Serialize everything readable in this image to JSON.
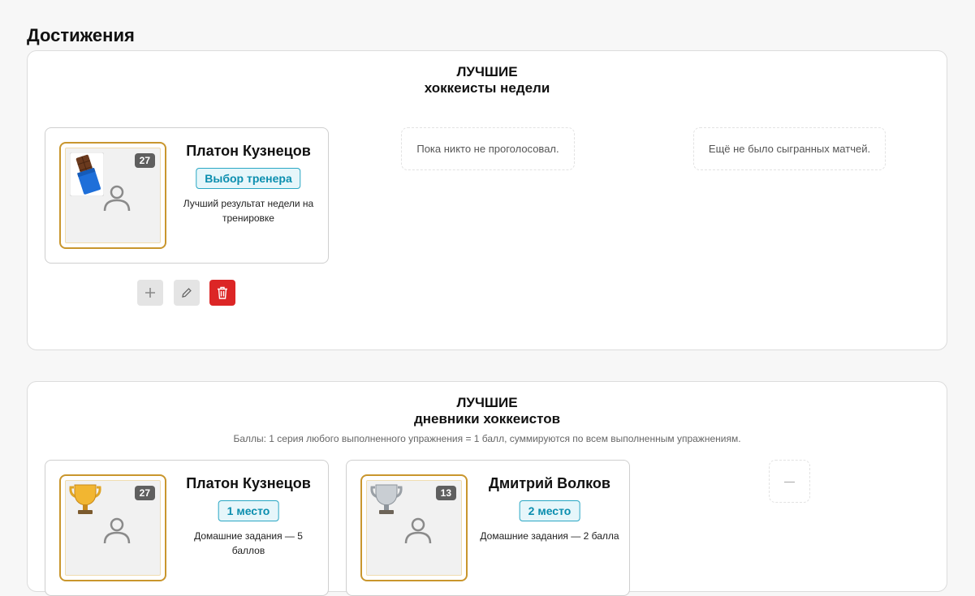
{
  "page": {
    "title": "Достижения"
  },
  "weekly": {
    "heading_line1": "ЛУЧШИЕ",
    "heading_line2": "хоккеисты недели",
    "card": {
      "name": "Платон Кузнецов",
      "count": "27",
      "award": "Выбор тренера",
      "description": "Лучший результат недели на тренировке",
      "badge_icon": "chocolate-bar-icon"
    },
    "empty_votes": "Пока никто не проголосовал.",
    "empty_matches": "Ещё не было сыгранных матчей.",
    "actions": [
      "plus-icon",
      "pencil-icon",
      "trash-icon"
    ]
  },
  "diaries": {
    "heading_line1": "ЛУЧШИЕ",
    "heading_line2": "дневники хоккеистов",
    "note": "Баллы: 1 серия любого выполненного упражнения = 1 балл, суммируются по всем выполненным упражнениям.",
    "cards": [
      {
        "name": "Платон Кузнецов",
        "count": "27",
        "place": "1 место",
        "description": "Домашние задания — 5 баллов",
        "badge_icon": "gold-trophy-icon"
      },
      {
        "name": "Дмитрий Волков",
        "count": "13",
        "place": "2 место",
        "description": "Домашние задания — 2 балла",
        "badge_icon": "silver-trophy-icon"
      }
    ],
    "empty_third": "—"
  },
  "colors": {
    "frame": "#c9962d",
    "accent": "#0b8eaf",
    "danger": "#dc2626"
  }
}
